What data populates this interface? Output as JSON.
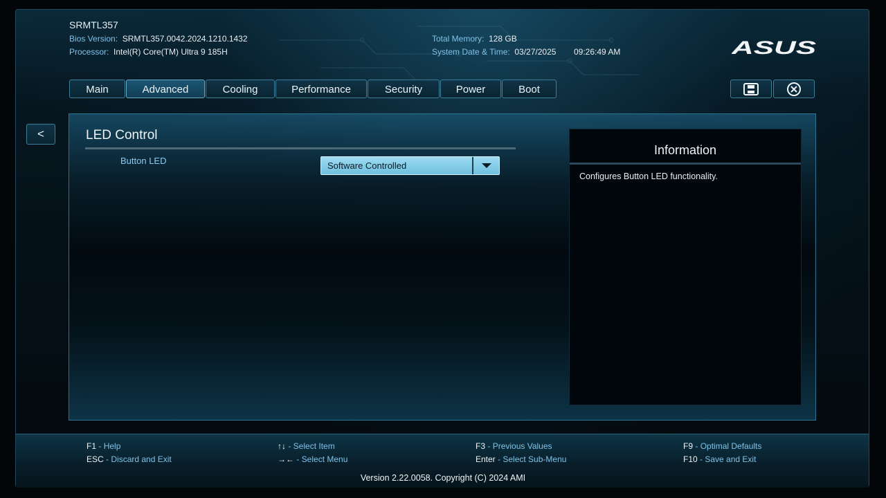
{
  "header": {
    "model": "SRMTL357",
    "bios_label": "Bios Version:",
    "bios_value": "SRMTL357.0042.2024.1210.1432",
    "processor_label": "Processor:",
    "processor_value": "Intel(R) Core(TM) Ultra 9 185H",
    "memory_label": "Total Memory:",
    "memory_value": "128 GB",
    "datetime_label": "System Date & Time:",
    "date_value": "03/27/2025",
    "time_value": "09:26:49 AM",
    "logo_text": "ASUS"
  },
  "tabs": [
    {
      "label": "Main"
    },
    {
      "label": "Advanced",
      "active": true
    },
    {
      "label": "Cooling"
    },
    {
      "label": "Performance"
    },
    {
      "label": "Security"
    },
    {
      "label": "Power"
    },
    {
      "label": "Boot"
    }
  ],
  "toolbar": {
    "save_icon": "save-icon",
    "exit_icon": "close-circle-icon"
  },
  "content": {
    "back_label": "<",
    "section_title": "LED Control",
    "items": [
      {
        "label": "Button LED",
        "value": "Software Controlled"
      }
    ]
  },
  "info": {
    "title": "Information",
    "text": "Configures Button LED functionality."
  },
  "footer": {
    "keys": [
      {
        "key": "F1",
        "desc": "Help"
      },
      {
        "key": "ESC",
        "desc": "Discard and Exit"
      },
      {
        "key": "↑↓",
        "desc": "Select Item"
      },
      {
        "key": "→←",
        "desc": "Select Menu"
      },
      {
        "key": "F3",
        "desc": "Previous Values"
      },
      {
        "key": "Enter",
        "desc": "Select Sub-Menu"
      },
      {
        "key": "F9",
        "desc": "Optimal Defaults"
      },
      {
        "key": "F10",
        "desc": "Save and Exit"
      }
    ],
    "version": "Version 2.22.0058. Copyright (C) 2024 AMI"
  },
  "colors": {
    "accent": "#7ec3ea",
    "dropdown": "#7fc8e5",
    "border": "#3f7e98"
  }
}
